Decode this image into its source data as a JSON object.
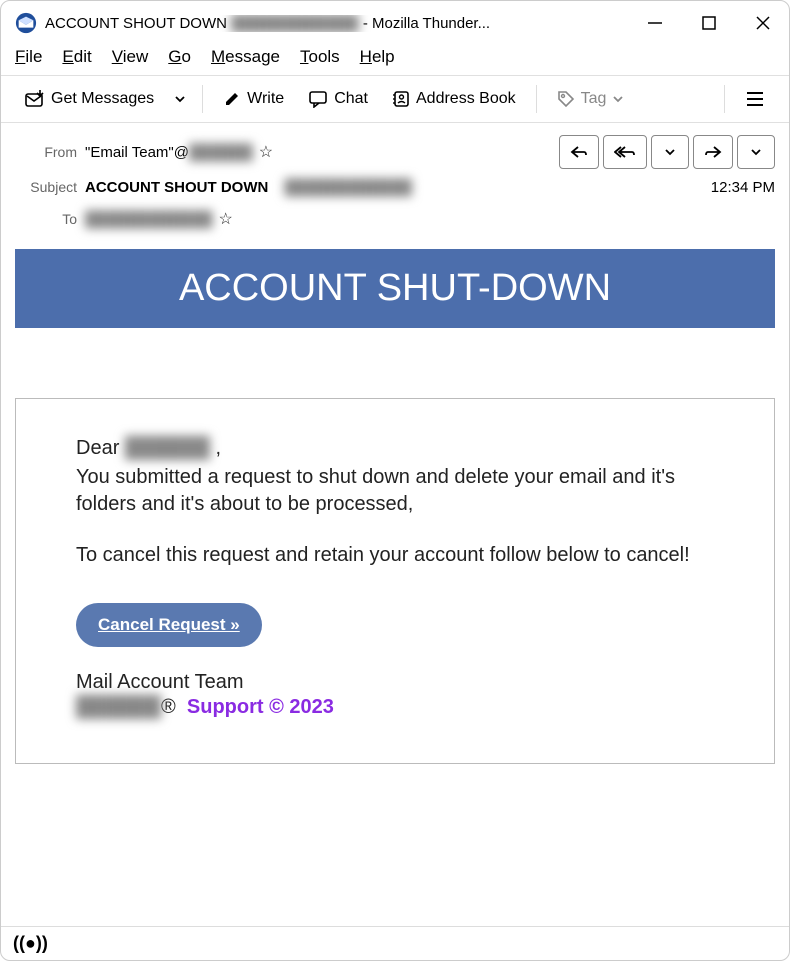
{
  "titlebar": {
    "title_prefix": "ACCOUNT SHOUT DOWN ",
    "title_redacted": "████████████",
    "title_suffix": " - Mozilla Thunder..."
  },
  "menubar": [
    "File",
    "Edit",
    "View",
    "Go",
    "Message",
    "Tools",
    "Help"
  ],
  "toolbar": {
    "get_messages": "Get Messages",
    "write": "Write",
    "chat": "Chat",
    "address_book": "Address Book",
    "tag": "Tag"
  },
  "headers": {
    "from_label": "From",
    "from_prefix": "\"Email Team\"@",
    "from_redacted": "██████",
    "subject_label": "Subject",
    "subject_text": "ACCOUNT SHOUT DOWN ",
    "subject_redacted": "████████████",
    "to_label": "To",
    "to_redacted": "████████████",
    "time": "12:34 PM"
  },
  "body": {
    "banner": "ACCOUNT SHUT-DOWN",
    "dear": "Dear  ",
    "dear_redacted": "██████",
    "dear_comma": " ,",
    "p1": "You submitted a request to shut down and delete your email and it's folders and it's about to be processed,",
    "p2": "To cancel this request and retain your account follow below to cancel!",
    "cta": "Cancel Request »",
    "sig_line1": "Mail Account Team",
    "sig_brand_redacted": "██████",
    "sig_reg": "® ",
    "sig_support": "Support ©  2023"
  }
}
